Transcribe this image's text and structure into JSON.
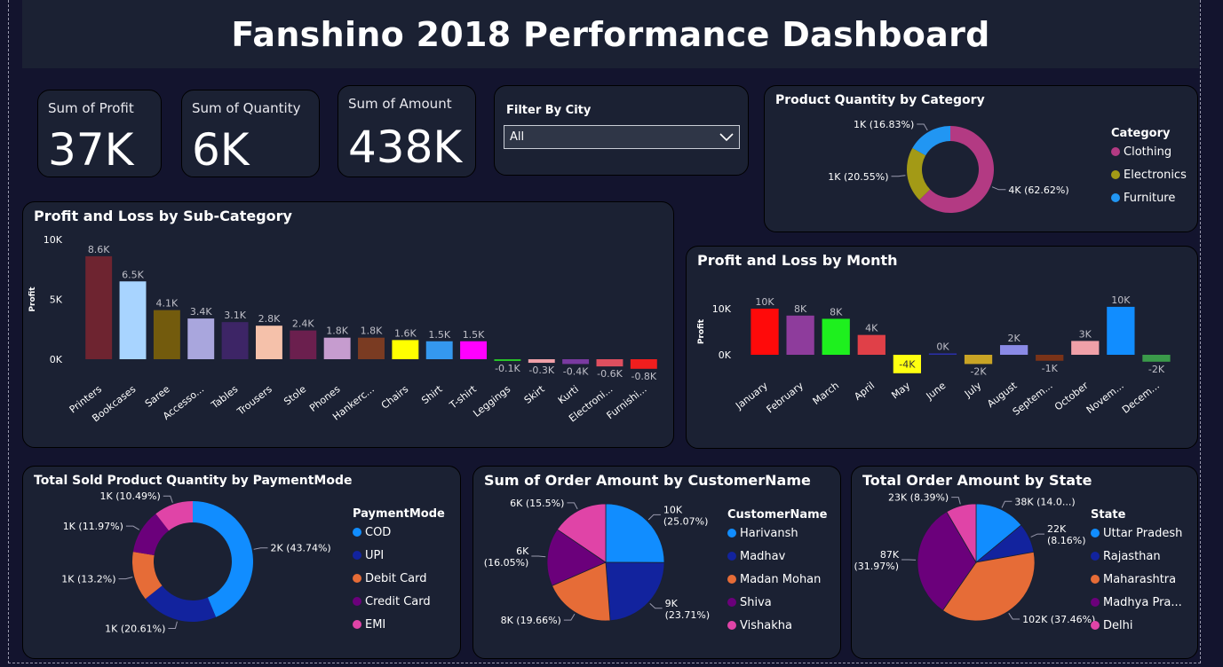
{
  "title": "Fanshino 2018 Performance Dashboard",
  "kpis": {
    "profit": {
      "label": "Sum of Profit",
      "value": "37K"
    },
    "quantity": {
      "label": "Sum of Quantity",
      "value": "6K"
    },
    "amount": {
      "label": "Sum of Amount",
      "value": "438K"
    }
  },
  "filter": {
    "label": "Filter By City",
    "value": "All"
  },
  "chart_data": [
    {
      "id": "subcat",
      "type": "bar",
      "title": "Profit and Loss by Sub-Category",
      "ylabel": "Profit",
      "ylim": [
        -1000,
        10000
      ],
      "yticks": [
        {
          "v": 10000,
          "label": "10K"
        },
        {
          "v": 5000,
          "label": "5K"
        },
        {
          "v": 0,
          "label": "0K"
        }
      ],
      "categories": [
        "Printers",
        "Bookcases",
        "Saree",
        "Accesso...",
        "Tables",
        "Trousers",
        "Stole",
        "Phones",
        "Hankerc...",
        "Chairs",
        "Shirt",
        "T-shirt",
        "Leggings",
        "Skirt",
        "Kurti",
        "Electroni...",
        "Furnishi..."
      ],
      "values": [
        8600,
        6500,
        4100,
        3400,
        3100,
        2800,
        2400,
        1800,
        1800,
        1600,
        1500,
        1500,
        -100,
        -300,
        -400,
        -600,
        -800
      ],
      "labels": [
        "8.6K",
        "6.5K",
        "4.1K",
        "3.4K",
        "3.1K",
        "2.8K",
        "2.4K",
        "1.8K",
        "1.8K",
        "1.6K",
        "1.5K",
        "1.5K",
        "-0.1K",
        "-0.3K",
        "-0.4K",
        "-0.6K",
        "-0.8K"
      ],
      "colors": [
        "#6e2430",
        "#a8d4ff",
        "#735b0d",
        "#a9a6dd",
        "#3d2566",
        "#f5c1aa",
        "#6b1f4e",
        "#c69ccf",
        "#7a3b22",
        "#ffff00",
        "#3498ef",
        "#ff00ff",
        "#27c227",
        "#f0a0a8",
        "#7a3aa0",
        "#de4f5f",
        "#f01e1e"
      ]
    },
    {
      "id": "month",
      "type": "bar",
      "title": "Profit and Loss by Month",
      "ylabel": "Profit",
      "ylim": [
        -4000,
        10000
      ],
      "yticks": [
        {
          "v": 10000,
          "label": "10K"
        },
        {
          "v": 0,
          "label": "0K"
        }
      ],
      "categories": [
        "January",
        "February",
        "March",
        "April",
        "May",
        "June",
        "July",
        "August",
        "Septem...",
        "October",
        "Novem...",
        "Decem..."
      ],
      "values": [
        10000,
        8500,
        7800,
        4300,
        -4000,
        300,
        -2000,
        2100,
        -1300,
        3000,
        10400,
        -1500
      ],
      "labels": [
        "10K",
        "8K",
        "8K",
        "4K",
        "-4K",
        "0K",
        "-2K",
        "2K",
        "-1K",
        "3K",
        "10K",
        "-2K"
      ],
      "colors": [
        "#ff0a0a",
        "#8e3c9c",
        "#1ef01e",
        "#e04048",
        "#ffff10",
        "#2a2fa8",
        "#c9a425",
        "#8a8ae6",
        "#7a3318",
        "#f0a0a8",
        "#118dff",
        "#3a9a4a"
      ]
    },
    {
      "id": "category",
      "type": "pie",
      "donut": true,
      "title": "Product Quantity by Category",
      "legend_title": "Category",
      "categories": [
        "Clothing",
        "Electronics",
        "Furniture"
      ],
      "values": [
        62.62,
        20.55,
        16.83
      ],
      "labels": [
        "4K (62.62%)",
        "1K (20.55%)",
        "1K (16.83%)"
      ],
      "colors": [
        "#b33a83",
        "#a39a16",
        "#2196f3"
      ]
    },
    {
      "id": "payment",
      "type": "pie",
      "donut": true,
      "title": "Total Sold Product Quantity by PaymentMode",
      "legend_title": "PaymentMode",
      "categories": [
        "COD",
        "UPI",
        "Debit Card",
        "Credit Card",
        "EMI"
      ],
      "values": [
        43.74,
        20.61,
        13.2,
        11.97,
        10.49
      ],
      "labels": [
        "2K (43.74%)",
        "1K (20.61%)",
        "1K (13.2%)",
        "1K (11.97%)",
        "1K (10.49%)"
      ],
      "colors": [
        "#118dff",
        "#12239e",
        "#e66c37",
        "#6b007b",
        "#e044a7"
      ]
    },
    {
      "id": "customer",
      "type": "pie",
      "donut": false,
      "title": "Sum of Order Amount by CustomerName",
      "legend_title": "CustomerName",
      "categories": [
        "Harivansh",
        "Madhav",
        "Madan Mohan",
        "Shiva",
        "Vishakha"
      ],
      "values": [
        25.07,
        23.71,
        19.66,
        16.05,
        15.5
      ],
      "labels": [
        [
          "10K",
          "(25.07%)"
        ],
        [
          "9K",
          "(23.71%)"
        ],
        [
          "8K (19.66%)"
        ],
        [
          "6K",
          "(16.05%)"
        ],
        [
          "6K (15.5%)"
        ]
      ],
      "colors": [
        "#118dff",
        "#12239e",
        "#e66c37",
        "#6b007b",
        "#e044a7"
      ]
    },
    {
      "id": "state",
      "type": "pie",
      "donut": false,
      "title": "Total Order Amount by State",
      "legend_title": "State",
      "categories": [
        "Uttar Pradesh",
        "Rajasthan",
        "Maharashtra",
        "Madhya Pra...",
        "Delhi"
      ],
      "values": [
        14.02,
        8.16,
        37.46,
        31.97,
        8.39
      ],
      "labels": [
        [
          "38K (14.0...)"
        ],
        [
          "22K",
          "(8.16%)"
        ],
        [
          "102K (37.46%)"
        ],
        [
          "87K",
          "(31.97%)"
        ],
        [
          "23K (8.39%)"
        ]
      ],
      "colors": [
        "#118dff",
        "#12239e",
        "#e66c37",
        "#6b007b",
        "#e044a7"
      ]
    }
  ]
}
